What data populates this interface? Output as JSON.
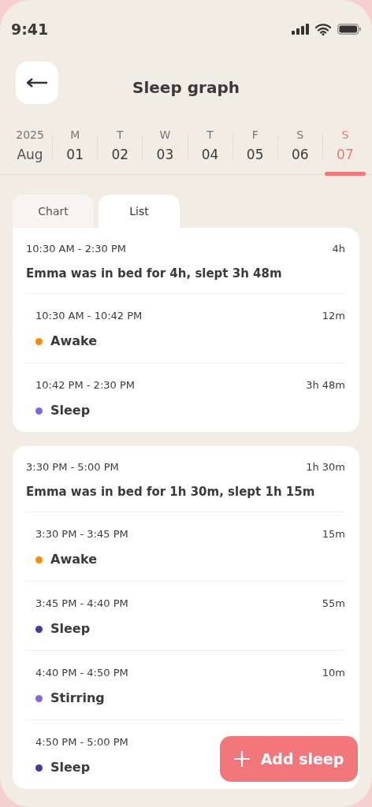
{
  "status_bar": {
    "time": "9:41"
  },
  "header": {
    "title": "Sleep graph"
  },
  "date_strip": {
    "year": "2025",
    "month": "Aug",
    "days": [
      {
        "weekday": "M",
        "day": "01",
        "selected": false
      },
      {
        "weekday": "T",
        "day": "02",
        "selected": false
      },
      {
        "weekday": "W",
        "day": "03",
        "selected": false
      },
      {
        "weekday": "T",
        "day": "04",
        "selected": false
      },
      {
        "weekday": "F",
        "day": "05",
        "selected": false
      },
      {
        "weekday": "S",
        "day": "06",
        "selected": false
      },
      {
        "weekday": "S",
        "day": "07",
        "selected": true
      }
    ]
  },
  "tabs": [
    {
      "label": "Chart",
      "selected": false
    },
    {
      "label": "List",
      "selected": true
    }
  ],
  "sessions": [
    {
      "time_range": "10:30 AM - 2:30 PM",
      "duration": "4h",
      "summary": "Emma was in bed for 4h, slept 3h 48m",
      "segments": [
        {
          "time_range": "10:30 AM - 10:42 PM",
          "duration": "12m",
          "state": "Awake",
          "color": "#ff8a00"
        },
        {
          "time_range": "10:42 PM - 2:30 PM",
          "duration": "3h 48m",
          "state": "Sleep",
          "color": "#8466e0"
        }
      ]
    },
    {
      "time_range": "3:30 PM - 5:00 PM",
      "duration": "1h 30m",
      "summary": "Emma was in bed for 1h 30m, slept 1h 15m",
      "segments": [
        {
          "time_range": "3:30 PM - 3:45 PM",
          "duration": "15m",
          "state": "Awake",
          "color": "#ff8a00"
        },
        {
          "time_range": "3:45 PM - 4:40 PM",
          "duration": "55m",
          "state": "Sleep",
          "color": "#4a34a8"
        },
        {
          "time_range": "4:40 PM - 4:50 PM",
          "duration": "10m",
          "state": "Stirring",
          "color": "#8466e0"
        },
        {
          "time_range": "4:50 PM - 5:00 PM",
          "state": "Sleep",
          "color": "#4a34a8"
        }
      ]
    }
  ],
  "add_button": {
    "label": "Add sleep"
  }
}
